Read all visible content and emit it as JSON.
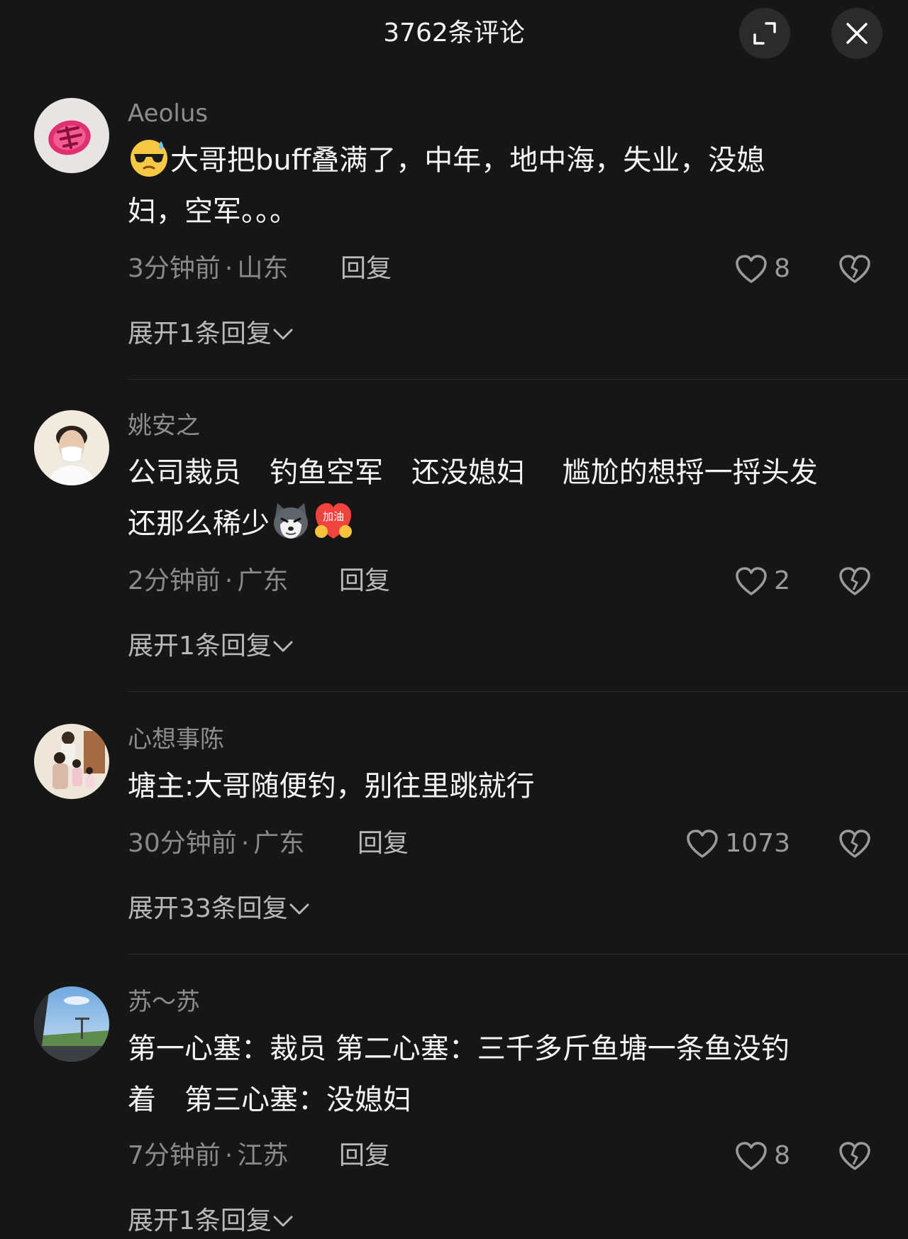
{
  "header": {
    "title": "3762条评论"
  },
  "comments": [
    {
      "username": "Aeolus",
      "lines": [
        "大哥把buff叠满了，中年，地中海，失业，没媳",
        "妇，空军。。。"
      ],
      "emoji_names": [
        "sunglasses-sweat-emoji"
      ],
      "time": "3分钟前",
      "location": "山东",
      "reply_label": "回复",
      "likes": "8",
      "expand_label": "展开1条回复"
    },
    {
      "username": "姚安之",
      "lines": [
        "公司裁员　钓鱼空军　还没媳妇　 尴尬的想捋一捋头发",
        "还那么稀少"
      ],
      "emoji_names": [
        "husky-dog-emoji",
        "jiayou-cheer-emoji"
      ],
      "emoji_text": "加油",
      "time": "2分钟前",
      "location": "广东",
      "reply_label": "回复",
      "likes": "2",
      "expand_label": "展开1条回复"
    },
    {
      "username": "心想事陈",
      "lines": [
        "塘主:大哥随便钓，别往里跳就行"
      ],
      "time": "30分钟前",
      "location": "广东",
      "reply_label": "回复",
      "likes": "1073",
      "expand_label": "展开33条回复"
    },
    {
      "username": "苏～苏",
      "lines": [
        "第一心塞：裁员  第二心塞：三千多斤鱼塘一条鱼没钓",
        "着　第三心塞：没媳妇"
      ],
      "time": "7分钟前",
      "location": "江苏",
      "reply_label": "回复",
      "likes": "8",
      "expand_label": "展开1条回复"
    }
  ],
  "meta_separator": "·",
  "icons": {
    "expand": "expand-icon",
    "close": "close-icon",
    "like": "heart-icon",
    "dislike": "broken-heart-icon",
    "chevron": "chevron-down-icon"
  },
  "colors": {
    "background": "#161616",
    "text_primary": "#f4f4f4",
    "text_secondary": "#8d8d8d",
    "button_bg": "#2b2b2b"
  }
}
